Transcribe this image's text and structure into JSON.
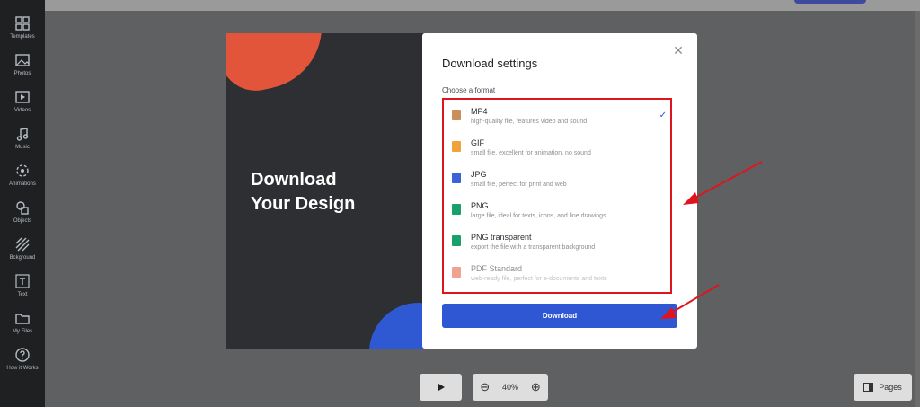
{
  "sidebar": {
    "items": [
      {
        "label": "Templates",
        "icon": "templates-icon"
      },
      {
        "label": "Photos",
        "icon": "photos-icon"
      },
      {
        "label": "Videos",
        "icon": "videos-icon"
      },
      {
        "label": "Music",
        "icon": "music-icon"
      },
      {
        "label": "Animations",
        "icon": "animations-icon"
      },
      {
        "label": "Objects",
        "icon": "objects-icon"
      },
      {
        "label": "Bckground",
        "icon": "background-icon"
      },
      {
        "label": "Text",
        "icon": "text-icon"
      },
      {
        "label": "My Files",
        "icon": "folder-icon"
      },
      {
        "label": "How it Works",
        "icon": "help-icon"
      }
    ]
  },
  "preview": {
    "title_line1": "Download",
    "title_line2": "Your Design"
  },
  "modal": {
    "title": "Download settings",
    "close_icon": "close-icon",
    "section_label": "Choose a format",
    "formats": [
      {
        "name": "MP4",
        "desc": "high-quality file, features video and sound",
        "color": "#c98e5a",
        "selected": true
      },
      {
        "name": "GIF",
        "desc": "small file, excellent for animation, no sound",
        "color": "#f0a33a",
        "selected": false
      },
      {
        "name": "JPG",
        "desc": "small file, perfect for print and web",
        "color": "#3b63d6",
        "selected": false
      },
      {
        "name": "PNG",
        "desc": "large file, ideal for texts, icons, and line drawings",
        "color": "#1aa06d",
        "selected": false
      },
      {
        "name": "PNG transparent",
        "desc": "export the file with a transparent background",
        "color": "#1aa06d",
        "selected": false
      },
      {
        "name": "PDF Standard",
        "desc": "web-ready file, perfect for e-documents and texts",
        "color": "#e2553a",
        "selected": false
      }
    ],
    "download_label": "Download"
  },
  "controls": {
    "zoom_value": "40%",
    "pages_label": "Pages"
  },
  "colors": {
    "accent": "#2f57d4",
    "highlight": "#e0141e"
  }
}
